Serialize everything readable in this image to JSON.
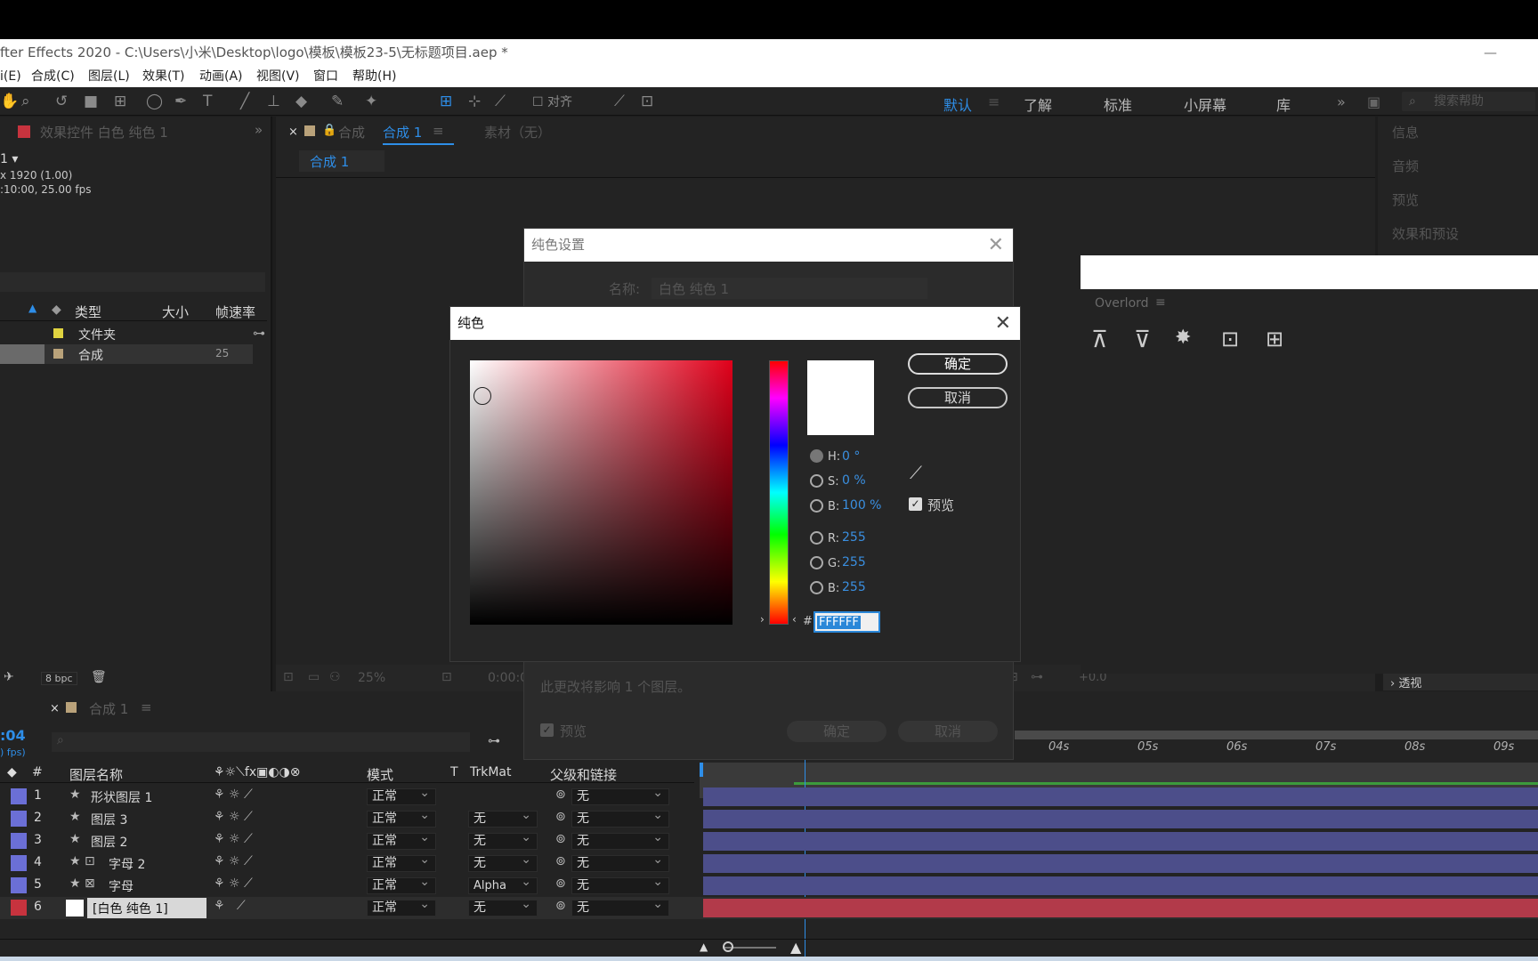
{
  "window": {
    "title": "fter Effects 2020 - C:\\Users\\小米\\Desktop\\logo\\模板\\模板23-5\\无标题项目.aep *",
    "minimize_glyph": "—"
  },
  "menu": [
    "i(E)",
    "合成(C)",
    "图层(L)",
    "效果(T)",
    "动画(A)",
    "视图(V)",
    "窗口",
    "帮助(H)"
  ],
  "toolbar": {
    "align_label": "对齐",
    "workspaces": [
      "默认",
      "了解",
      "标准",
      "小屏幕",
      "库"
    ],
    "active_workspace": "默认",
    "search_placeholder": "搜索帮助",
    "more": "»"
  },
  "left_panel": {
    "tab": "效果控件 白色 纯色 1",
    "comp_name": "1 ▾",
    "comp_size": "x 1920 (1.00)",
    "comp_duration": ":10:00, 25.00 fps",
    "col_type": "类型",
    "col_size": "大小",
    "col_fps": "帧速率",
    "items": [
      {
        "type": "文件夹",
        "fps": ""
      },
      {
        "type": "合成",
        "fps": "25"
      }
    ],
    "bpc": "8 bpc"
  },
  "comp_panel": {
    "tab_prefix": "合成",
    "tab_name": "合成 1",
    "footage_tab": "素材（无）",
    "breadcrumb": "合成 1",
    "zoom": "25%",
    "time": "0:00:0",
    "exposure": "+0.0"
  },
  "right_panel": {
    "items": [
      "信息",
      "音频",
      "预览",
      "效果和预设"
    ],
    "bottom_item": "› 透视"
  },
  "overlord": {
    "title": "Overlord"
  },
  "solid_settings": {
    "title": "纯色设置",
    "name_label": "名称:",
    "name_value": "白色 纯色 1",
    "affect_note": "此更改将影响 1 个图层。",
    "preview_label": "预览",
    "ok": "确定",
    "cancel": "取消"
  },
  "color_dialog": {
    "title": "纯色",
    "ok": "确定",
    "cancel": "取消",
    "h_label": "H:",
    "h_value": "0 °",
    "s_label": "S:",
    "s_value": "0 %",
    "b_label": "B:",
    "b_value": "100 %",
    "r_label": "R:",
    "r_value": "255",
    "g_label": "G:",
    "g_value": "255",
    "bb_label": "B:",
    "bb_value": "255",
    "hex_prefix": "#",
    "hex_value": "FFFFFF",
    "preview_label": "预览",
    "selected_color": "#FFFFFF"
  },
  "timeline": {
    "tab": "合成 1",
    "timecode": ":04",
    "fps_note": ") fps)",
    "col_hash": "#",
    "col_name": "图层名称",
    "col_mode": "模式",
    "col_t": "T",
    "col_trkmat": "TrkMat",
    "col_parent": "父级和链接",
    "ticks": [
      "04s",
      "05s",
      "06s",
      "07s",
      "08s",
      "09s"
    ],
    "layers": [
      {
        "num": "1",
        "name": "形状图层 1",
        "mode": "正常",
        "trkmat": "",
        "parent": "无",
        "color": "#6b6fd6"
      },
      {
        "num": "2",
        "name": "图层 3",
        "mode": "正常",
        "trkmat": "无",
        "parent": "无",
        "color": "#6b6fd6"
      },
      {
        "num": "3",
        "name": "图层 2",
        "mode": "正常",
        "trkmat": "无",
        "parent": "无",
        "color": "#6b6fd6"
      },
      {
        "num": "4",
        "name": "字母 2",
        "mode": "正常",
        "trkmat": "无",
        "parent": "无",
        "color": "#6b6fd6"
      },
      {
        "num": "5",
        "name": "字母",
        "mode": "正常",
        "trkmat": "Alpha",
        "parent": "无",
        "color": "#6b6fd6"
      },
      {
        "num": "6",
        "name": "[白色 纯色 1]",
        "mode": "正常",
        "trkmat": "无",
        "parent": "无",
        "color": "#c7333e"
      }
    ]
  }
}
